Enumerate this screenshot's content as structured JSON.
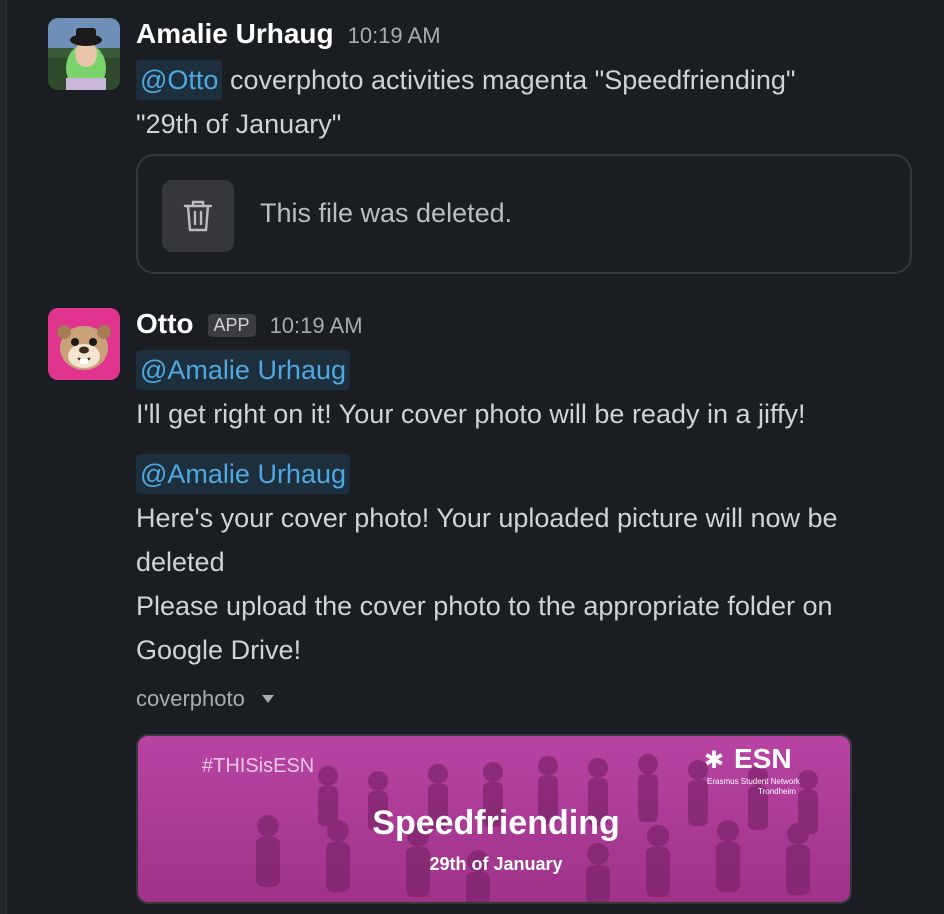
{
  "messages": [
    {
      "author": "Amalie Urhaug",
      "time": "10:19 AM",
      "mention": "@Otto",
      "text_line1": " coverphoto activities magenta \"Speedfriending\"",
      "text_line2": "\"29th of January\"",
      "attachment_status": "This file was deleted."
    },
    {
      "author": "Otto",
      "badge": "APP",
      "time": "10:19 AM",
      "mention1": "@Amalie Urhaug",
      "text1": "I'll get right on it! Your cover photo will be ready in a jiffy!",
      "mention2": "@Amalie Urhaug",
      "text2_line1": "Here's your cover photo! Your uploaded picture will now be",
      "text2_line2": "deleted",
      "text3_line1": "Please upload the cover photo to the appropriate folder on",
      "text3_line2": "Google Drive!",
      "file_label": "coverphoto",
      "cover": {
        "hashtag": "#THISisESN",
        "logo": "ESN",
        "logo_sub1": "Erasmus Student Network",
        "logo_sub2": "Trondheim",
        "title": "Speedfriending",
        "date": "29th of January"
      }
    }
  ],
  "colors": {
    "background": "#1a1d21",
    "mention": "#4fa8e0",
    "magenta_overlay": "#c2389a"
  }
}
